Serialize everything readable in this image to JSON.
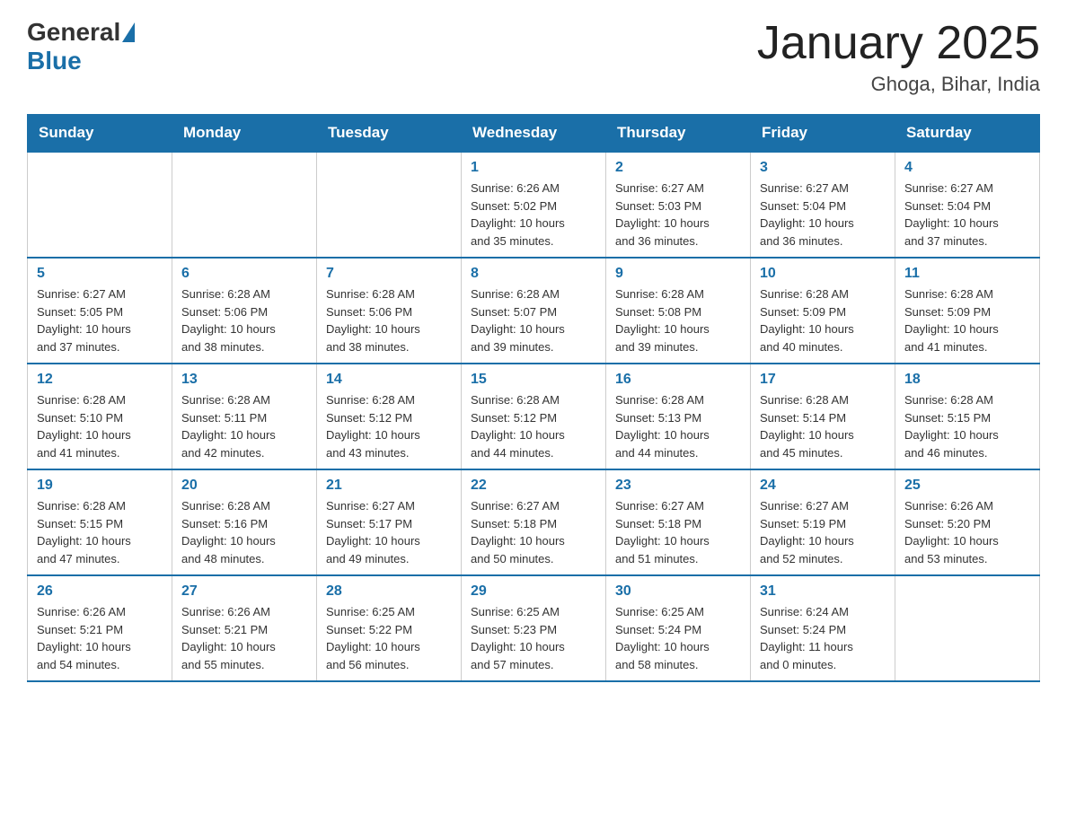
{
  "header": {
    "logo_text_general": "General",
    "logo_text_blue": "Blue",
    "month_title": "January 2025",
    "location": "Ghoga, Bihar, India"
  },
  "weekdays": [
    "Sunday",
    "Monday",
    "Tuesday",
    "Wednesday",
    "Thursday",
    "Friday",
    "Saturday"
  ],
  "weeks": [
    [
      {
        "day": "",
        "info": ""
      },
      {
        "day": "",
        "info": ""
      },
      {
        "day": "",
        "info": ""
      },
      {
        "day": "1",
        "info": "Sunrise: 6:26 AM\nSunset: 5:02 PM\nDaylight: 10 hours\nand 35 minutes."
      },
      {
        "day": "2",
        "info": "Sunrise: 6:27 AM\nSunset: 5:03 PM\nDaylight: 10 hours\nand 36 minutes."
      },
      {
        "day": "3",
        "info": "Sunrise: 6:27 AM\nSunset: 5:04 PM\nDaylight: 10 hours\nand 36 minutes."
      },
      {
        "day": "4",
        "info": "Sunrise: 6:27 AM\nSunset: 5:04 PM\nDaylight: 10 hours\nand 37 minutes."
      }
    ],
    [
      {
        "day": "5",
        "info": "Sunrise: 6:27 AM\nSunset: 5:05 PM\nDaylight: 10 hours\nand 37 minutes."
      },
      {
        "day": "6",
        "info": "Sunrise: 6:28 AM\nSunset: 5:06 PM\nDaylight: 10 hours\nand 38 minutes."
      },
      {
        "day": "7",
        "info": "Sunrise: 6:28 AM\nSunset: 5:06 PM\nDaylight: 10 hours\nand 38 minutes."
      },
      {
        "day": "8",
        "info": "Sunrise: 6:28 AM\nSunset: 5:07 PM\nDaylight: 10 hours\nand 39 minutes."
      },
      {
        "day": "9",
        "info": "Sunrise: 6:28 AM\nSunset: 5:08 PM\nDaylight: 10 hours\nand 39 minutes."
      },
      {
        "day": "10",
        "info": "Sunrise: 6:28 AM\nSunset: 5:09 PM\nDaylight: 10 hours\nand 40 minutes."
      },
      {
        "day": "11",
        "info": "Sunrise: 6:28 AM\nSunset: 5:09 PM\nDaylight: 10 hours\nand 41 minutes."
      }
    ],
    [
      {
        "day": "12",
        "info": "Sunrise: 6:28 AM\nSunset: 5:10 PM\nDaylight: 10 hours\nand 41 minutes."
      },
      {
        "day": "13",
        "info": "Sunrise: 6:28 AM\nSunset: 5:11 PM\nDaylight: 10 hours\nand 42 minutes."
      },
      {
        "day": "14",
        "info": "Sunrise: 6:28 AM\nSunset: 5:12 PM\nDaylight: 10 hours\nand 43 minutes."
      },
      {
        "day": "15",
        "info": "Sunrise: 6:28 AM\nSunset: 5:12 PM\nDaylight: 10 hours\nand 44 minutes."
      },
      {
        "day": "16",
        "info": "Sunrise: 6:28 AM\nSunset: 5:13 PM\nDaylight: 10 hours\nand 44 minutes."
      },
      {
        "day": "17",
        "info": "Sunrise: 6:28 AM\nSunset: 5:14 PM\nDaylight: 10 hours\nand 45 minutes."
      },
      {
        "day": "18",
        "info": "Sunrise: 6:28 AM\nSunset: 5:15 PM\nDaylight: 10 hours\nand 46 minutes."
      }
    ],
    [
      {
        "day": "19",
        "info": "Sunrise: 6:28 AM\nSunset: 5:15 PM\nDaylight: 10 hours\nand 47 minutes."
      },
      {
        "day": "20",
        "info": "Sunrise: 6:28 AM\nSunset: 5:16 PM\nDaylight: 10 hours\nand 48 minutes."
      },
      {
        "day": "21",
        "info": "Sunrise: 6:27 AM\nSunset: 5:17 PM\nDaylight: 10 hours\nand 49 minutes."
      },
      {
        "day": "22",
        "info": "Sunrise: 6:27 AM\nSunset: 5:18 PM\nDaylight: 10 hours\nand 50 minutes."
      },
      {
        "day": "23",
        "info": "Sunrise: 6:27 AM\nSunset: 5:18 PM\nDaylight: 10 hours\nand 51 minutes."
      },
      {
        "day": "24",
        "info": "Sunrise: 6:27 AM\nSunset: 5:19 PM\nDaylight: 10 hours\nand 52 minutes."
      },
      {
        "day": "25",
        "info": "Sunrise: 6:26 AM\nSunset: 5:20 PM\nDaylight: 10 hours\nand 53 minutes."
      }
    ],
    [
      {
        "day": "26",
        "info": "Sunrise: 6:26 AM\nSunset: 5:21 PM\nDaylight: 10 hours\nand 54 minutes."
      },
      {
        "day": "27",
        "info": "Sunrise: 6:26 AM\nSunset: 5:21 PM\nDaylight: 10 hours\nand 55 minutes."
      },
      {
        "day": "28",
        "info": "Sunrise: 6:25 AM\nSunset: 5:22 PM\nDaylight: 10 hours\nand 56 minutes."
      },
      {
        "day": "29",
        "info": "Sunrise: 6:25 AM\nSunset: 5:23 PM\nDaylight: 10 hours\nand 57 minutes."
      },
      {
        "day": "30",
        "info": "Sunrise: 6:25 AM\nSunset: 5:24 PM\nDaylight: 10 hours\nand 58 minutes."
      },
      {
        "day": "31",
        "info": "Sunrise: 6:24 AM\nSunset: 5:24 PM\nDaylight: 11 hours\nand 0 minutes."
      },
      {
        "day": "",
        "info": ""
      }
    ]
  ]
}
